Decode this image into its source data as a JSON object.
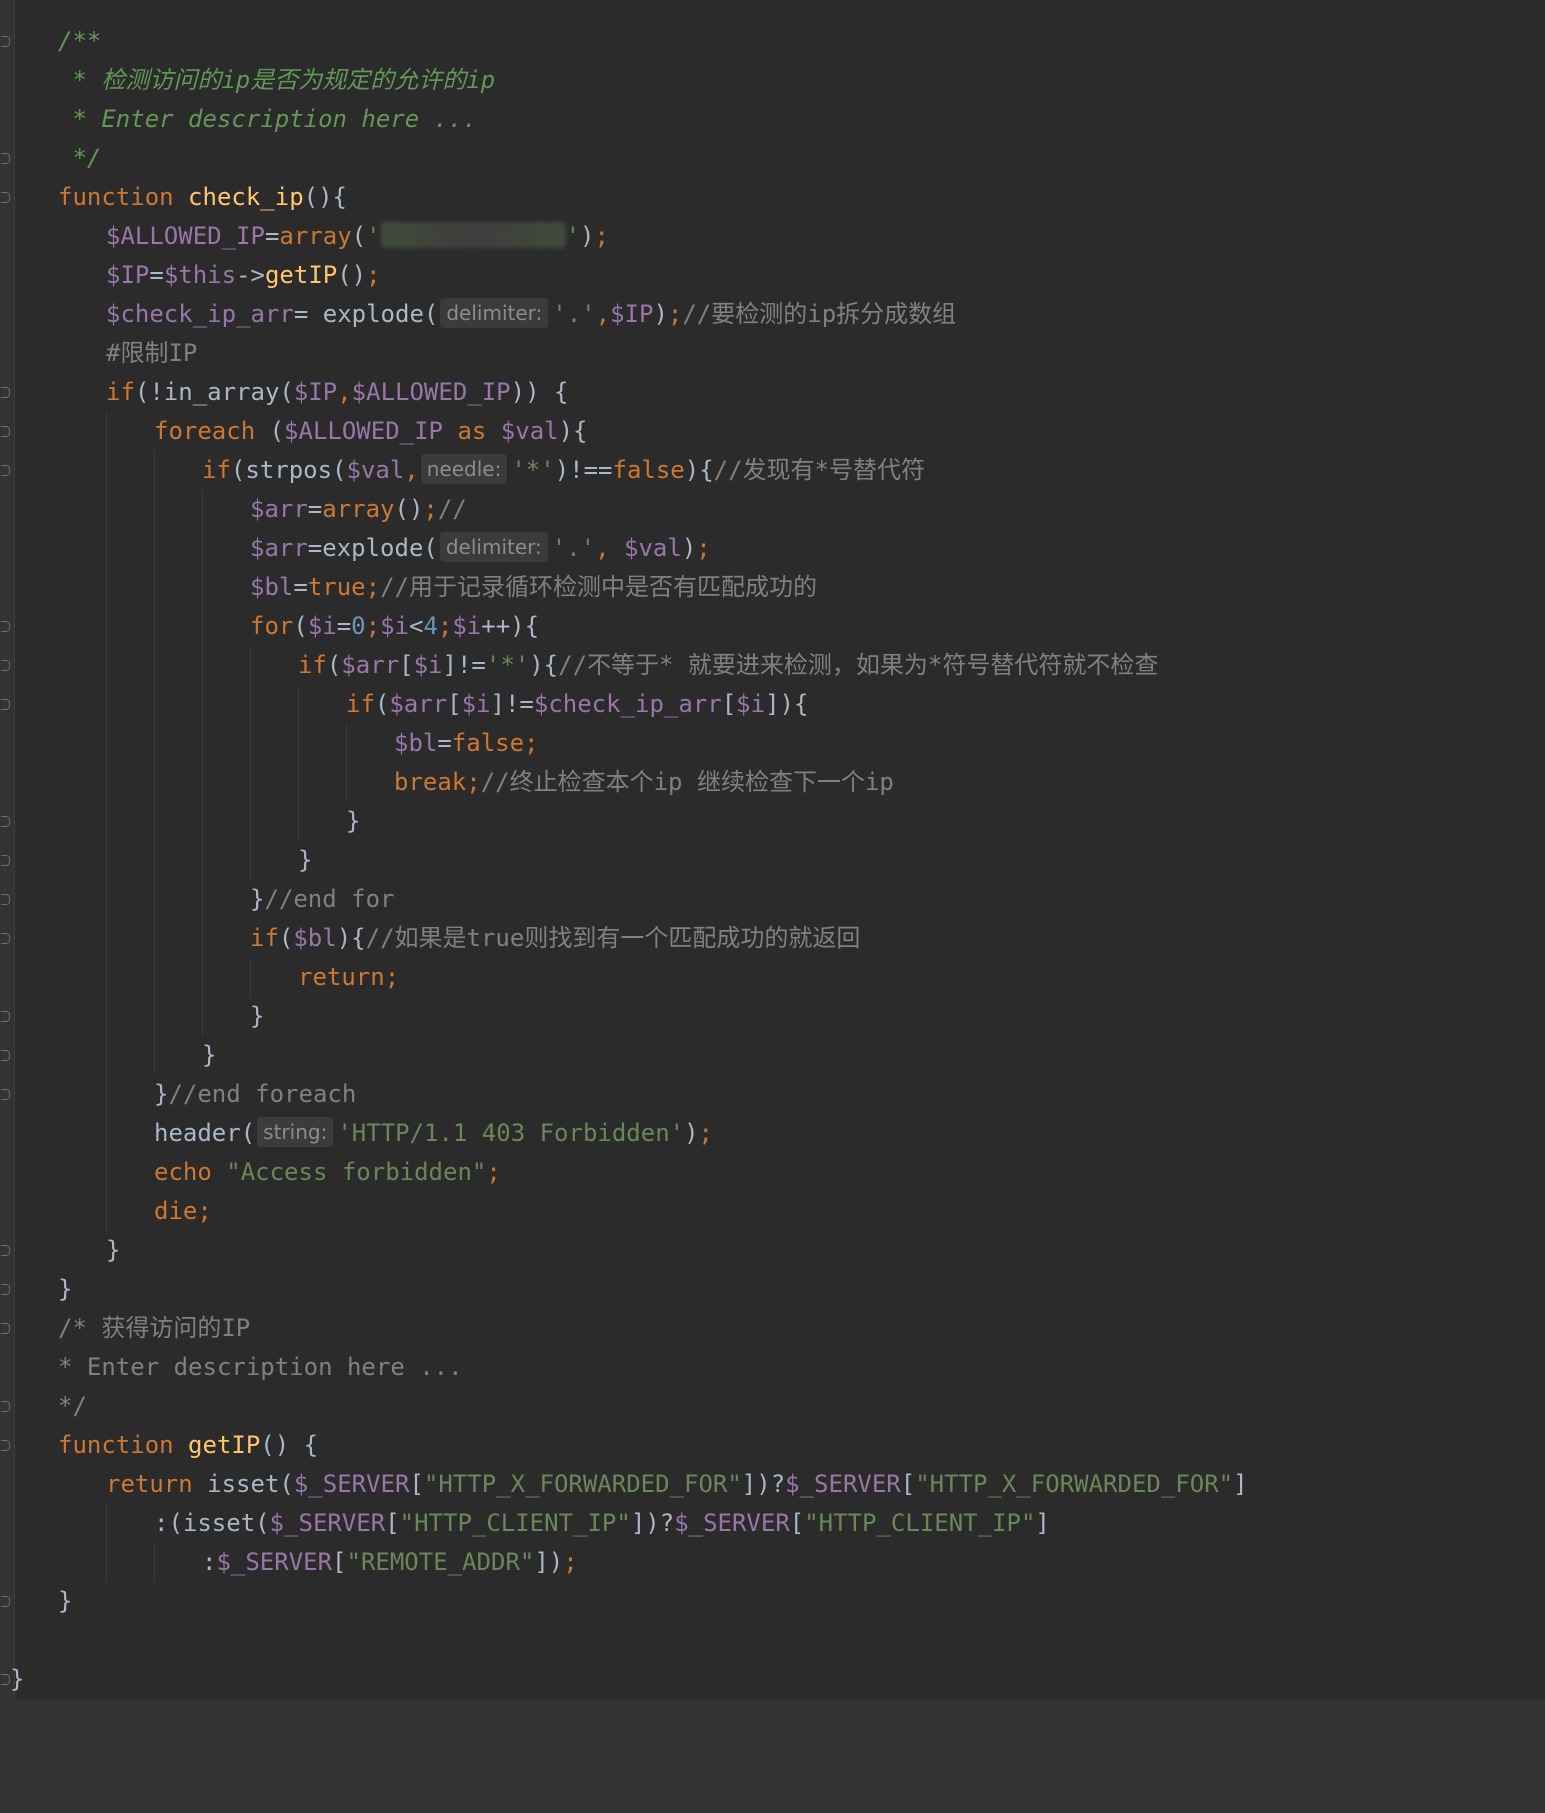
{
  "editor": {
    "theme": "dark",
    "colors": {
      "background": "#2b2b2b",
      "keyword": "#cc7832",
      "variable": "#9876aa",
      "function": "#ffc66d",
      "string": "#6a8759",
      "number": "#6897bb",
      "comment": "#808080",
      "doc_comment": "#629755"
    },
    "lines": [
      {
        "indent": 1,
        "tokens": [
          {
            "t": "doc",
            "v": "/**"
          }
        ]
      },
      {
        "indent": 1,
        "tokens": [
          {
            "t": "doc",
            "v": " * 检测访问的ip是否为规定的允许的ip"
          }
        ]
      },
      {
        "indent": 1,
        "tokens": [
          {
            "t": "doc",
            "v": " * Enter description here ..."
          }
        ]
      },
      {
        "indent": 1,
        "tokens": [
          {
            "t": "doc",
            "v": " */"
          }
        ]
      },
      {
        "indent": 1,
        "tokens": [
          {
            "t": "kw",
            "v": "function "
          },
          {
            "t": "fn",
            "v": "check_ip"
          },
          {
            "t": "plain",
            "v": "(){"
          }
        ]
      },
      {
        "indent": 2,
        "tokens": [
          {
            "t": "var",
            "v": "$ALLOWED_IP"
          },
          {
            "t": "plain",
            "v": "="
          },
          {
            "t": "kw",
            "v": "array"
          },
          {
            "t": "plain",
            "v": "("
          },
          {
            "t": "str",
            "v": "'"
          },
          {
            "t": "blur",
            "v": ""
          },
          {
            "t": "str",
            "v": "'"
          },
          {
            "t": "plain",
            "v": ")"
          },
          {
            "t": "kw",
            "v": ";"
          }
        ]
      },
      {
        "indent": 2,
        "tokens": [
          {
            "t": "var",
            "v": "$IP"
          },
          {
            "t": "plain",
            "v": "="
          },
          {
            "t": "var",
            "v": "$this"
          },
          {
            "t": "plain",
            "v": "->"
          },
          {
            "t": "fn",
            "v": "getIP"
          },
          {
            "t": "plain",
            "v": "()"
          },
          {
            "t": "kw",
            "v": ";"
          }
        ]
      },
      {
        "indent": 2,
        "tokens": [
          {
            "t": "var",
            "v": "$check_ip_arr"
          },
          {
            "t": "plain",
            "v": "= explode("
          },
          {
            "t": "hint",
            "v": "delimiter:"
          },
          {
            "t": "str",
            "v": "'.'"
          },
          {
            "t": "kw",
            "v": ","
          },
          {
            "t": "var",
            "v": "$IP"
          },
          {
            "t": "plain",
            "v": ")"
          },
          {
            "t": "kw",
            "v": ";"
          },
          {
            "t": "cm",
            "v": "//要检测的ip拆分成数组"
          }
        ]
      },
      {
        "indent": 2,
        "tokens": [
          {
            "t": "cm",
            "v": "#限制IP"
          }
        ]
      },
      {
        "indent": 2,
        "tokens": [
          {
            "t": "kw",
            "v": "if"
          },
          {
            "t": "plain",
            "v": "(!in_array("
          },
          {
            "t": "var",
            "v": "$IP"
          },
          {
            "t": "kw",
            "v": ","
          },
          {
            "t": "var",
            "v": "$ALLOWED_IP"
          },
          {
            "t": "plain",
            "v": ")) {"
          }
        ]
      },
      {
        "indent": 3,
        "tokens": [
          {
            "t": "kw",
            "v": "foreach "
          },
          {
            "t": "plain",
            "v": "("
          },
          {
            "t": "var",
            "v": "$ALLOWED_IP "
          },
          {
            "t": "kw",
            "v": "as "
          },
          {
            "t": "var",
            "v": "$val"
          },
          {
            "t": "plain",
            "v": "){"
          }
        ]
      },
      {
        "indent": 4,
        "tokens": [
          {
            "t": "kw",
            "v": "if"
          },
          {
            "t": "plain",
            "v": "(strpos("
          },
          {
            "t": "var",
            "v": "$val"
          },
          {
            "t": "kw",
            "v": ","
          },
          {
            "t": "hint",
            "v": "needle:"
          },
          {
            "t": "str",
            "v": "'*'"
          },
          {
            "t": "plain",
            "v": ")!=="
          },
          {
            "t": "kw",
            "v": "false"
          },
          {
            "t": "plain",
            "v": "){"
          },
          {
            "t": "cm",
            "v": "//发现有*号替代符"
          }
        ]
      },
      {
        "indent": 5,
        "tokens": [
          {
            "t": "var",
            "v": "$arr"
          },
          {
            "t": "plain",
            "v": "="
          },
          {
            "t": "kw",
            "v": "array"
          },
          {
            "t": "plain",
            "v": "()"
          },
          {
            "t": "kw",
            "v": ";"
          },
          {
            "t": "cm",
            "v": "//"
          }
        ]
      },
      {
        "indent": 5,
        "tokens": [
          {
            "t": "var",
            "v": "$arr"
          },
          {
            "t": "plain",
            "v": "=explode("
          },
          {
            "t": "hint",
            "v": "delimiter:"
          },
          {
            "t": "str",
            "v": "'.'"
          },
          {
            "t": "kw",
            "v": ", "
          },
          {
            "t": "var",
            "v": "$val"
          },
          {
            "t": "plain",
            "v": ")"
          },
          {
            "t": "kw",
            "v": ";"
          }
        ]
      },
      {
        "indent": 5,
        "tokens": [
          {
            "t": "var",
            "v": "$bl"
          },
          {
            "t": "plain",
            "v": "="
          },
          {
            "t": "kw",
            "v": "true;"
          },
          {
            "t": "cm",
            "v": "//用于记录循环检测中是否有匹配成功的"
          }
        ]
      },
      {
        "indent": 5,
        "tokens": [
          {
            "t": "kw",
            "v": "for"
          },
          {
            "t": "plain",
            "v": "("
          },
          {
            "t": "var",
            "v": "$i"
          },
          {
            "t": "plain",
            "v": "="
          },
          {
            "t": "num",
            "v": "0"
          },
          {
            "t": "kw",
            "v": ";"
          },
          {
            "t": "var",
            "v": "$i"
          },
          {
            "t": "plain",
            "v": "<"
          },
          {
            "t": "num",
            "v": "4"
          },
          {
            "t": "kw",
            "v": ";"
          },
          {
            "t": "var",
            "v": "$i"
          },
          {
            "t": "plain",
            "v": "++){"
          }
        ]
      },
      {
        "indent": 6,
        "tokens": [
          {
            "t": "kw",
            "v": "if"
          },
          {
            "t": "plain",
            "v": "("
          },
          {
            "t": "var",
            "v": "$arr"
          },
          {
            "t": "plain",
            "v": "["
          },
          {
            "t": "var",
            "v": "$i"
          },
          {
            "t": "plain",
            "v": "]!="
          },
          {
            "t": "str",
            "v": "'*'"
          },
          {
            "t": "plain",
            "v": "){"
          },
          {
            "t": "cm",
            "v": "//不等于* 就要进来检测，如果为*符号替代符就不检查"
          }
        ]
      },
      {
        "indent": 7,
        "tokens": [
          {
            "t": "kw",
            "v": "if"
          },
          {
            "t": "plain",
            "v": "("
          },
          {
            "t": "var",
            "v": "$arr"
          },
          {
            "t": "plain",
            "v": "["
          },
          {
            "t": "var",
            "v": "$i"
          },
          {
            "t": "plain",
            "v": "]!="
          },
          {
            "t": "var",
            "v": "$check_ip_arr"
          },
          {
            "t": "plain",
            "v": "["
          },
          {
            "t": "var",
            "v": "$i"
          },
          {
            "t": "plain",
            "v": "]){"
          }
        ]
      },
      {
        "indent": 8,
        "tokens": [
          {
            "t": "var",
            "v": "$bl"
          },
          {
            "t": "plain",
            "v": "="
          },
          {
            "t": "kw",
            "v": "false;"
          }
        ]
      },
      {
        "indent": 8,
        "tokens": [
          {
            "t": "kw",
            "v": "break;"
          },
          {
            "t": "cm",
            "v": "//终止检查本个ip 继续检查下一个ip"
          }
        ]
      },
      {
        "indent": 7,
        "tokens": [
          {
            "t": "plain",
            "v": "}"
          }
        ]
      },
      {
        "indent": 6,
        "tokens": [
          {
            "t": "plain",
            "v": "}"
          }
        ]
      },
      {
        "indent": 5,
        "tokens": [
          {
            "t": "plain",
            "v": "}"
          },
          {
            "t": "cm",
            "v": "//end for"
          }
        ]
      },
      {
        "indent": 5,
        "tokens": [
          {
            "t": "kw",
            "v": "if"
          },
          {
            "t": "plain",
            "v": "("
          },
          {
            "t": "var",
            "v": "$bl"
          },
          {
            "t": "plain",
            "v": "){"
          },
          {
            "t": "cm",
            "v": "//如果是true则找到有一个匹配成功的就返回"
          }
        ]
      },
      {
        "indent": 6,
        "tokens": [
          {
            "t": "kw",
            "v": "return;"
          }
        ]
      },
      {
        "indent": 5,
        "tokens": [
          {
            "t": "plain",
            "v": "}"
          }
        ]
      },
      {
        "indent": 4,
        "tokens": [
          {
            "t": "plain",
            "v": "}"
          }
        ]
      },
      {
        "indent": 3,
        "tokens": [
          {
            "t": "plain",
            "v": "}"
          },
          {
            "t": "cm",
            "v": "//end foreach"
          }
        ]
      },
      {
        "indent": 3,
        "tokens": [
          {
            "t": "plain",
            "v": "header("
          },
          {
            "t": "hint",
            "v": "string:"
          },
          {
            "t": "str",
            "v": "'HTTP/1.1 403 Forbidden'"
          },
          {
            "t": "plain",
            "v": ")"
          },
          {
            "t": "kw",
            "v": ";"
          }
        ]
      },
      {
        "indent": 3,
        "tokens": [
          {
            "t": "kw",
            "v": "echo "
          },
          {
            "t": "str",
            "v": "\"Access forbidden\""
          },
          {
            "t": "kw",
            "v": ";"
          }
        ]
      },
      {
        "indent": 3,
        "tokens": [
          {
            "t": "kw",
            "v": "die;"
          }
        ]
      },
      {
        "indent": 2,
        "tokens": [
          {
            "t": "plain",
            "v": "}"
          }
        ]
      },
      {
        "indent": 1,
        "tokens": [
          {
            "t": "plain",
            "v": "}"
          }
        ]
      },
      {
        "indent": 1,
        "tokens": [
          {
            "t": "cm",
            "v": "/* 获得访问的IP"
          }
        ]
      },
      {
        "indent": 1,
        "tokens": [
          {
            "t": "cm",
            "v": "* Enter description here ..."
          }
        ]
      },
      {
        "indent": 1,
        "tokens": [
          {
            "t": "cm",
            "v": "*/"
          }
        ]
      },
      {
        "indent": 1,
        "tokens": [
          {
            "t": "kw",
            "v": "function "
          },
          {
            "t": "fn",
            "v": "getIP"
          },
          {
            "t": "plain",
            "v": "() {"
          }
        ]
      },
      {
        "indent": 2,
        "tokens": [
          {
            "t": "kw",
            "v": "return "
          },
          {
            "t": "plain",
            "v": "isset("
          },
          {
            "t": "var",
            "v": "$_SERVER"
          },
          {
            "t": "plain",
            "v": "["
          },
          {
            "t": "str",
            "v": "\"HTTP_X_FORWARDED_FOR\""
          },
          {
            "t": "plain",
            "v": "])?"
          },
          {
            "t": "var",
            "v": "$_SERVER"
          },
          {
            "t": "plain",
            "v": "["
          },
          {
            "t": "str",
            "v": "\"HTTP_X_FORWARDED_FOR\""
          },
          {
            "t": "plain",
            "v": "]"
          }
        ]
      },
      {
        "indent": 3,
        "tokens": [
          {
            "t": "plain",
            "v": ":(isset("
          },
          {
            "t": "var",
            "v": "$_SERVER"
          },
          {
            "t": "plain",
            "v": "["
          },
          {
            "t": "str",
            "v": "\"HTTP_CLIENT_IP\""
          },
          {
            "t": "plain",
            "v": "])?"
          },
          {
            "t": "var",
            "v": "$_SERVER"
          },
          {
            "t": "plain",
            "v": "["
          },
          {
            "t": "str",
            "v": "\"HTTP_CLIENT_IP\""
          },
          {
            "t": "plain",
            "v": "]"
          }
        ]
      },
      {
        "indent": 4,
        "tokens": [
          {
            "t": "plain",
            "v": ":"
          },
          {
            "t": "var",
            "v": "$_SERVER"
          },
          {
            "t": "plain",
            "v": "["
          },
          {
            "t": "str",
            "v": "\"REMOTE_ADDR\""
          },
          {
            "t": "plain",
            "v": "])"
          },
          {
            "t": "kw",
            "v": ";"
          }
        ]
      },
      {
        "indent": 1,
        "tokens": [
          {
            "t": "plain",
            "v": "}"
          }
        ]
      },
      {
        "indent": 0,
        "tokens": []
      },
      {
        "indent": 0,
        "tokens": [
          {
            "t": "plain",
            "v": "}"
          }
        ]
      }
    ]
  }
}
